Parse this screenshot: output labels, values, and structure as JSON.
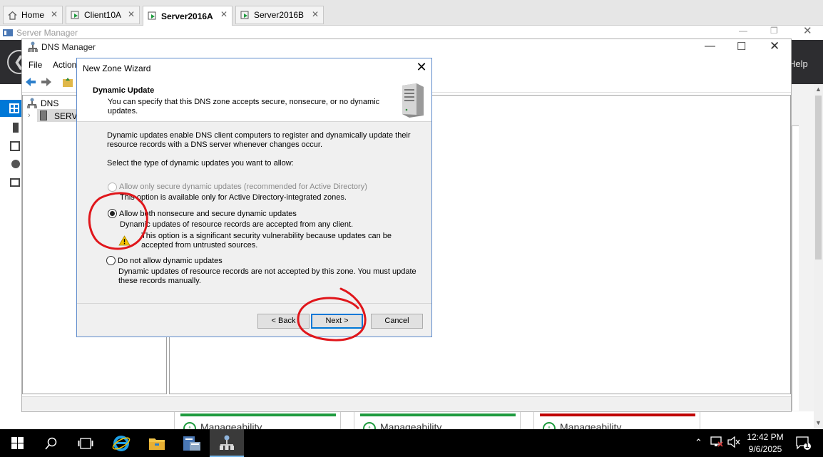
{
  "browser_tabs": [
    {
      "label": "Home",
      "active": false
    },
    {
      "label": "Client10A",
      "active": false
    },
    {
      "label": "Server2016A",
      "active": true
    },
    {
      "label": "Server2016B",
      "active": false
    }
  ],
  "server_manager": {
    "title": "Server Manager",
    "help": "Help",
    "tiles": [
      {
        "label": "Manageability",
        "bar_color": "#1e9b3e"
      },
      {
        "label": "Manageability",
        "bar_color": "#1e9b3e"
      },
      {
        "label": "Manageability",
        "bar_color": "#c00000"
      }
    ]
  },
  "dns_manager": {
    "title": "DNS Manager",
    "menu": {
      "file": "File",
      "action": "Action"
    },
    "tree": {
      "root": "DNS",
      "server": "SERVE"
    }
  },
  "wizard": {
    "title": "New Zone Wizard",
    "header_title": "Dynamic Update",
    "header_subtitle": "You can specify that this DNS zone accepts secure, nonsecure, or no dynamic updates.",
    "intro": "Dynamic updates enable DNS client computers to register and dynamically update their resource records with a DNS server whenever changes occur.",
    "prompt": "Select the type of dynamic updates you want to allow:",
    "options": [
      {
        "label": "Allow only secure dynamic updates (recommended for Active Directory)",
        "description": "This option is available only for Active Directory-integrated zones.",
        "enabled": false,
        "selected": false
      },
      {
        "label": "Allow both nonsecure and secure dynamic updates",
        "description": "Dynamic updates of resource records are accepted from any client.",
        "warning": "This option is a significant security vulnerability because updates can be accepted from untrusted sources.",
        "enabled": true,
        "selected": true
      },
      {
        "label": "Do not allow dynamic updates",
        "description": "Dynamic updates of resource records are not accepted by this zone. You must update these records manually.",
        "enabled": true,
        "selected": false
      }
    ],
    "buttons": {
      "back": "< Back",
      "next": "Next >",
      "cancel": "Cancel"
    }
  },
  "taskbar": {
    "time": "12:42 PM",
    "date": "9/6/2025",
    "notification_count": "1"
  },
  "colors": {
    "annotation": "#e0161b",
    "selection_blue": "#0078d7",
    "taskbar": "#000000"
  }
}
